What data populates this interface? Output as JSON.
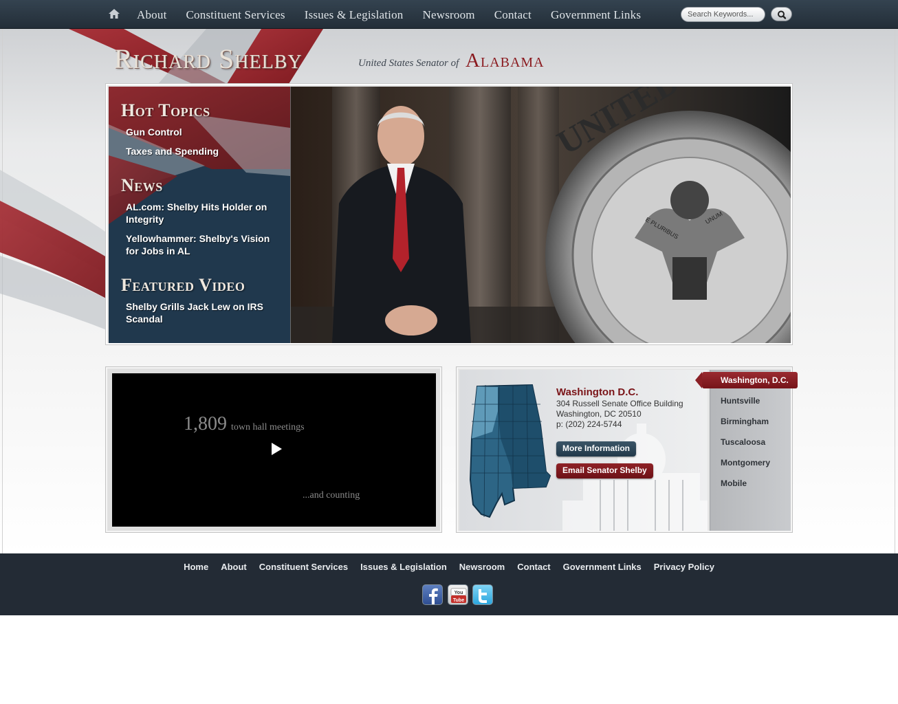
{
  "nav": {
    "items": [
      "About",
      "Constituent Services",
      "Issues & Legislation",
      "Newsroom",
      "Contact",
      "Government Links"
    ],
    "search_placeholder": "Search Keywords..."
  },
  "header": {
    "name": "Richard Shelby",
    "subtitle": "United States Senator of",
    "state": "Alabama"
  },
  "hero": {
    "hot_topics_title": "Hot Topics",
    "hot_topics": [
      "Gun Control",
      "Taxes and Spending"
    ],
    "news_title": "News",
    "news": [
      "AL.com: Shelby Hits Holder on Integrity",
      "Yellowhammer: Shelby's Vision for Jobs in AL"
    ],
    "featured_title": "Featured Video",
    "featured": [
      "Shelby Grills Jack Lew on IRS Scandal"
    ],
    "seal_text": "UNITED STATES",
    "seal_motto": [
      "E PLURIBUS",
      "UNUM"
    ]
  },
  "video": {
    "count": "1,809",
    "count_label": "town hall meetings",
    "counting": "...and counting"
  },
  "office": {
    "name": "Washington D.C.",
    "lines": [
      "304 Russell Senate Office Building",
      "Washington, DC 20510",
      "p: (202) 224-5744"
    ],
    "more_label": "More Information",
    "email_label": "Email Senator Shelby",
    "tabs": [
      "Washington, D.C.",
      "Huntsville",
      "Birmingham",
      "Tuscaloosa",
      "Montgomery",
      "Mobile"
    ],
    "active_tab": "Washington, D.C."
  },
  "footer": {
    "links": [
      "Home",
      "About",
      "Constituent Services",
      "Issues & Legislation",
      "Newsroom",
      "Contact",
      "Government Links",
      "Privacy Policy"
    ],
    "social": [
      "facebook-icon",
      "youtube-icon",
      "twitter-icon"
    ]
  },
  "colors": {
    "nav_bg": "#2b3843",
    "accent_red": "#8a1a1f",
    "navy": "#1e3549",
    "footer_bg": "#232b35"
  }
}
